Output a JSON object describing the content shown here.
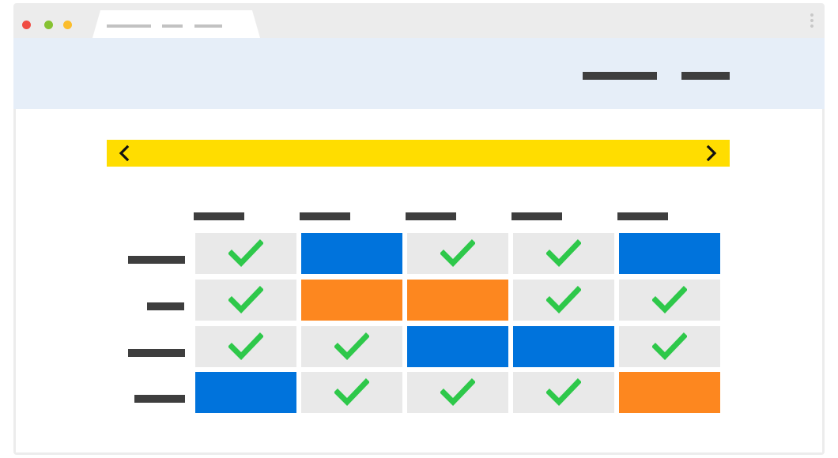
{
  "colors": {
    "window_chrome": "#ececec",
    "header_bg": "#e6eef8",
    "banner": "#ffdd00",
    "available": "#e9e9e9",
    "check": "#2ec84a",
    "blue": "#0073dc",
    "orange": "#fd871f",
    "placeholder_text": "#3e3e3e",
    "close_dot": "#f04c43",
    "minimize_dot": "#86c232",
    "maximize_dot": "#fbbd2c"
  },
  "browser": {
    "traffic_lights": [
      "close-dot",
      "minimize-dot",
      "maximize-dot"
    ],
    "tab_title_icon": "placeholder-text-bars",
    "menu_icon": "vertical-ellipsis-icon"
  },
  "header": {
    "nav_items": [
      "nav-link-placeholder",
      "nav-link-placeholder"
    ]
  },
  "calendar": {
    "prev_icon": "chevron-left-icon",
    "next_icon": "chevron-right-icon",
    "columns": 5,
    "rows": [
      [
        "check",
        "blue",
        "check",
        "check",
        "blue"
      ],
      [
        "check",
        "orange",
        "orange",
        "check",
        "check"
      ],
      [
        "check",
        "check",
        "blue",
        "blue",
        "check"
      ],
      [
        "blue",
        "check",
        "check",
        "check",
        "orange"
      ]
    ]
  }
}
